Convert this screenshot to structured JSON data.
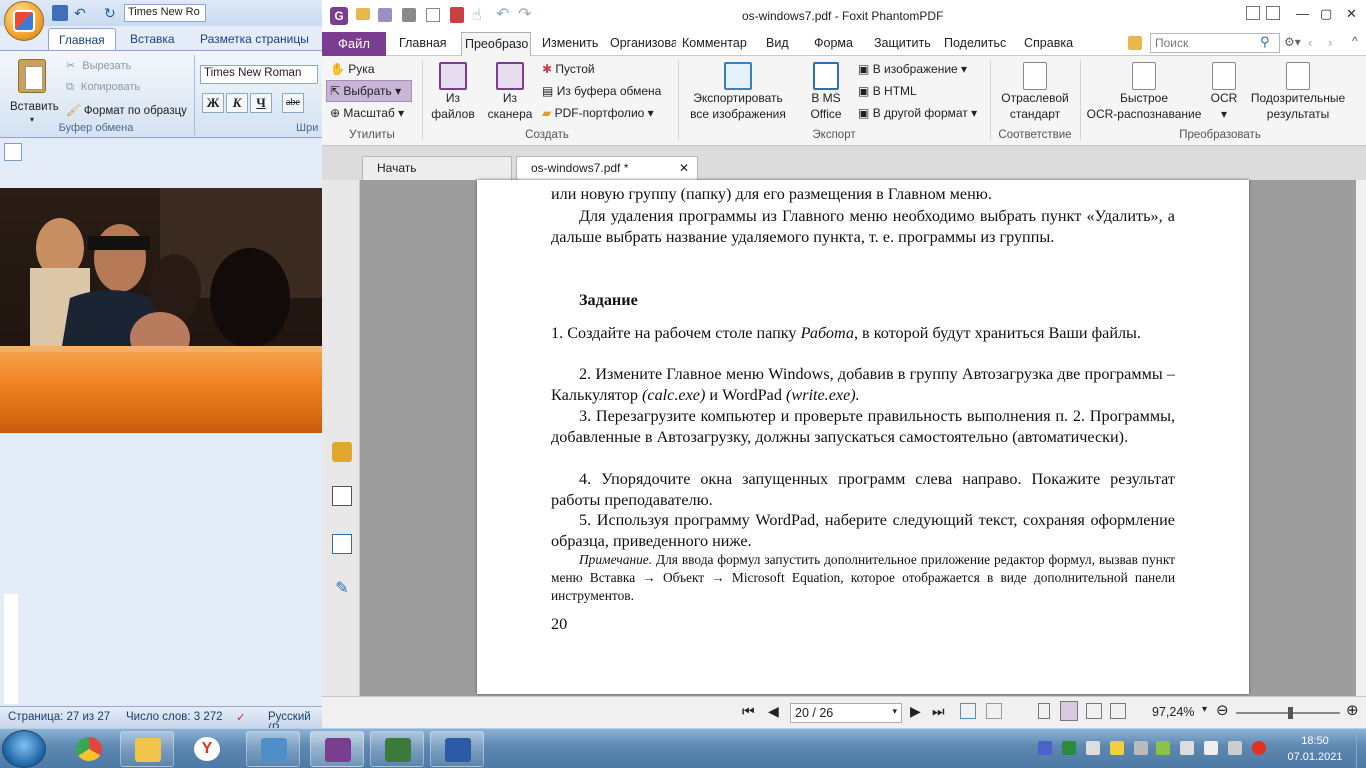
{
  "word": {
    "font_name_qat": "Times New Ro",
    "tabs": [
      "Главная",
      "Вставка",
      "Разметка страницы"
    ],
    "paste_label": "Вставить",
    "cut": "Вырезать",
    "copy": "Копировать",
    "format_painter": "Формат по образцу",
    "clipboard_group": "Буфер обмена",
    "font_name": "Times New Roman",
    "fmt_bold": "Ж",
    "fmt_italic": "К",
    "fmt_underline": "Ч",
    "fmt_strike": "abe",
    "font_group_cut": "Шри",
    "status": {
      "page": "Страница: 27 из 27",
      "words": "Число слов: 3 272",
      "lang": "Русский (Р"
    }
  },
  "foxit": {
    "title": "os-windows7.pdf - Foxit PhantomPDF",
    "menu": [
      "Главная",
      "Изменить",
      "Организова",
      "Комментар",
      "Вид",
      "Форма",
      "Защитить",
      "Поделитьс",
      "Справка"
    ],
    "file_tab": "Файл",
    "active_tab": "Преобразо",
    "search_placeholder": "Поиск",
    "ribbon": {
      "hand": "Рука",
      "select": "Выбрать",
      "zoom": "Масштаб",
      "utilities": "Утилиты",
      "from_files": "Из\nфайлов",
      "from_scanner": "Из\nсканера",
      "blank": "Пустой",
      "from_clipboard": "Из буфера обмена",
      "pdf_portfolio": "PDF-портфолио",
      "create": "Создать",
      "export_images": "Экспортировать\nвсе изображения",
      "to_ms_office": "В MS\nOffice",
      "to_image": "В изображение",
      "to_html": "В HTML",
      "to_other": "В другой формат",
      "export": "Экспорт",
      "industry_std": "Отраслевой\nстандарт",
      "compliance": "Соответствие",
      "quick_ocr": "Быстрое\nOCR-распознавание",
      "ocr": "OCR",
      "suspicious": "Подозрительные\nрезультаты",
      "convert": "Преобразовать"
    },
    "doc_tabs": [
      "Начать",
      "os-windows7.pdf *"
    ],
    "page_nav": "20 / 26",
    "zoom": "97,24%"
  },
  "document": {
    "line0": "или новую группу (папку) для его размещения в Главном меню.",
    "para1": "Для удаления программы из Главного меню необходимо выбрать пункт «Удалить», а дальше выбрать название удаляемого пункта, т. е. программы из группы.",
    "heading": "Задание",
    "item1a": "1.  Создайте на рабочем столе папку ",
    "item1b": "Работа",
    "item1c": ", в которой будут храниться Ваши файлы.",
    "item2a": "2.  Измените Главное меню Windows, добавив в группу Автозагрузка две программы – Калькулятор ",
    "item2b": "(calc.exe)",
    "item2c": " и WordPad ",
    "item2d": "(write.exe).",
    "item3": "3.  Перезагрузите компьютер и проверьте правильность выполнения п. 2. Программы, добавленные в Автозагрузку, должны запускаться самостоятельно (автоматически).",
    "item4": "4.  Упорядочите окна запущенных программ слева направо. Покажите результат работы преподавателю.",
    "item5": "5.  Используя программу WordPad, наберите следующий текст, сохраняя оформление образца, приведенного ниже.",
    "note_label": "Примечание.",
    "note_text": " Для ввода формул запустить дополнительное приложение редактор формул, вызвав пункт меню Вставка → Объект → Microsoft Equation, которое отображается в виде дополнительной панели инструментов.",
    "page_number": "20"
  },
  "taskbar": {
    "time": "18:50",
    "date": "07.01.2021"
  },
  "colors": {
    "foxit_purple": "#7b3d8f",
    "word_blue": "#15428b",
    "taskbar": "#5d87b0"
  }
}
